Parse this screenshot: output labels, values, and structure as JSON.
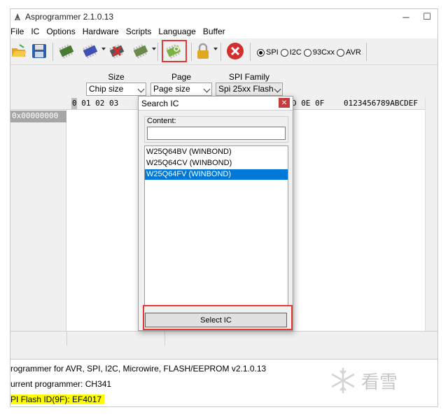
{
  "window": {
    "title": "Asprogrammer 2.1.0.13",
    "controls": {
      "minimize": "─",
      "maximize": "☐"
    }
  },
  "menu": [
    "File",
    "IC",
    "Options",
    "Hardware",
    "Scripts",
    "Language",
    "Buffer"
  ],
  "toolbar": {
    "icons": [
      "open-folder-icon",
      "save-icon",
      "read-chip-icon",
      "write-chip-icon",
      "erase-chip-icon",
      "verify-chip-icon",
      "search-ic-icon",
      "lock-icon",
      "stop-icon"
    ],
    "protocols": [
      {
        "label": "SPI",
        "selected": true
      },
      {
        "label": "I2C",
        "selected": false
      },
      {
        "label": "93Cxx",
        "selected": false
      },
      {
        "label": "AVR",
        "selected": false
      }
    ]
  },
  "options": {
    "size_label": "Size",
    "size_value": "Chip size",
    "page_label": "Page",
    "page_value": "Page size",
    "family_label": "SPI Family",
    "family_value": "Spi 25xx Flash"
  },
  "hex": {
    "header_left": "0 01 02 03",
    "header_first_digit": "0",
    "header_right": "D 0E 0F",
    "ascii_header": "0123456789ABCDEF",
    "address": "0x00000000"
  },
  "dialog": {
    "title": "Search IC",
    "close": "✕",
    "content_label": "Content:",
    "content_value": "",
    "items": [
      {
        "label": "W25Q64BV (WINBOND)",
        "selected": false
      },
      {
        "label": "W25Q64CV (WINBOND)",
        "selected": false
      },
      {
        "label": "W25Q64FV (WINBOND)",
        "selected": true
      }
    ],
    "select_button": "Select IC"
  },
  "log": [
    "rogrammer for AVR, SPI, I2C, Microwire, FLASH/EEPROM v2.1.0.13",
    "urrent programmer: CH341",
    "PI Flash ID(9F): EF4017"
  ],
  "watermark": {
    "text": "看雪"
  },
  "colors": {
    "highlight_red": "#e53935",
    "selection_blue": "#0078d7",
    "log_highlight": "#ffff00"
  }
}
